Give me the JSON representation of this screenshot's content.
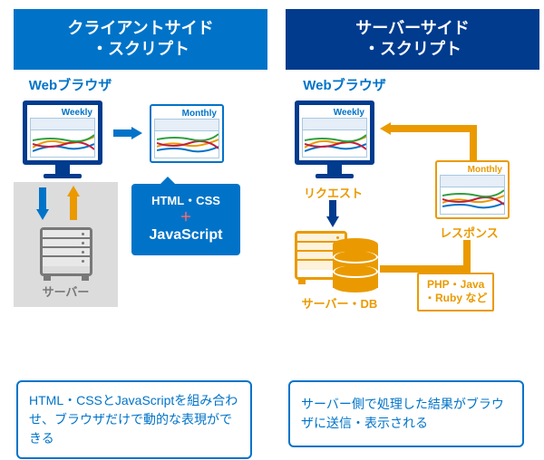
{
  "left": {
    "header": "クライアントサイド\n・スクリプト",
    "header_line1": "クライアントサイド",
    "header_line2": "・スクリプト",
    "browser_label": "Webブラウザ",
    "chart1": "Weekly",
    "chart2": "Monthly",
    "callout_line1": "HTML・CSS",
    "callout_plus": "＋",
    "callout_line2": "JavaScript",
    "server_label": "サーバー",
    "footer": "HTML・CSSとJavaScriptを組み合わせ、ブラウザだけで動的な表現ができる"
  },
  "right": {
    "header_line1": "サーバーサイド",
    "header_line2": "・スクリプト",
    "browser_label": "Webブラウザ",
    "chart1": "Weekly",
    "chart2": "Monthly",
    "request_label": "リクエスト",
    "response_label": "レスポンス",
    "server_label": "サーバー・DB",
    "langs_line1": "PHP・Java",
    "langs_line2": "・Ruby など",
    "footer": "サーバー側で処理した結果がブラウザに送信・表示される"
  }
}
